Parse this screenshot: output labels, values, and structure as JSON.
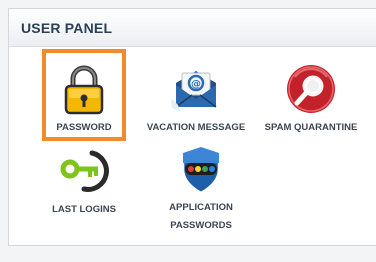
{
  "panel": {
    "title": "USER PANEL",
    "accent_color": "#f08a2c"
  },
  "tiles": [
    {
      "label": "PASSWORD",
      "icon": "padlock-icon",
      "selected": true
    },
    {
      "label": "VACATION MESSAGE",
      "icon": "envelope-at-icon",
      "selected": false
    },
    {
      "label": "SPAM QUARANTINE",
      "icon": "spam-magnifier-icon",
      "selected": false
    },
    {
      "label": "LAST LOGINS",
      "icon": "key-icon",
      "selected": false
    },
    {
      "label_line1": "APPLICATION",
      "label_line2": "PASSWORDS",
      "icon": "shield-dots-icon",
      "selected": false
    }
  ]
}
